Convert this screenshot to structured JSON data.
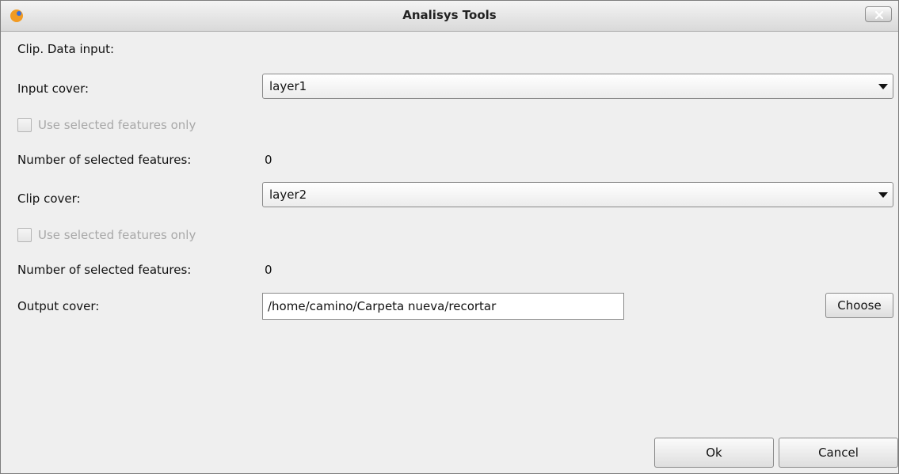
{
  "window": {
    "title": "Analisys Tools"
  },
  "colors": {
    "app_icon": "#f29b23",
    "app_icon_accent": "#3a6fd8"
  },
  "form": {
    "section_title": "Clip. Data input:",
    "input_cover_label": "Input cover:",
    "input_cover_value": "layer1",
    "input_use_selected_label": "Use selected features only",
    "input_use_selected_checked": false,
    "input_selected_count_label": "Number of selected features:",
    "input_selected_count": "0",
    "clip_cover_label": "Clip cover:",
    "clip_cover_value": "layer2",
    "clip_use_selected_label": "Use selected features only",
    "clip_use_selected_checked": false,
    "clip_selected_count_label": "Number of selected features:",
    "clip_selected_count": "0",
    "output_cover_label": "Output cover:",
    "output_cover_value": "/home/camino/Carpeta nueva/recortar",
    "choose_label": "Choose"
  },
  "buttons": {
    "ok_label": "Ok",
    "cancel_label": "Cancel"
  },
  "icons": {
    "app": "app-icon",
    "close": "close-icon",
    "dropdown": "chevron-down-icon"
  }
}
